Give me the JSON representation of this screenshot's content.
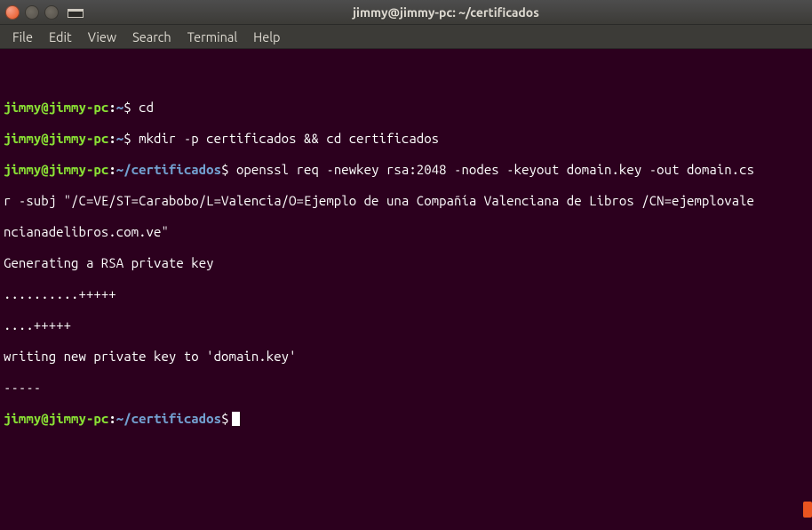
{
  "window": {
    "title": "jimmy@jimmy-pc: ~/certificados"
  },
  "menubar": {
    "file": "File",
    "edit": "Edit",
    "view": "View",
    "search": "Search",
    "terminal": "Terminal",
    "help": "Help"
  },
  "prompt": {
    "user_host": "jimmy@jimmy-pc",
    "colon": ":",
    "path_home": "~",
    "path_cert": "~/certificados",
    "dollar": "$"
  },
  "lines": {
    "cmd1": " cd",
    "cmd2": " mkdir -p certificados && cd certificados",
    "cmd3a": " openssl req -newkey rsa:2048 -nodes -keyout domain.key -out domain.cs",
    "cmd3b": "r -subj \"/C=VE/ST=Carabobo/L=Valencia/O=Ejemplo de una Compañía Valenciana de Libros /CN=ejemplovale",
    "cmd3c": "ncianadelibros.com.ve\"",
    "out1": "Generating a RSA private key",
    "out2": "..........+++++",
    "out3": "....+++++",
    "out4": "writing new private key to 'domain.key'",
    "out5": "-----"
  }
}
